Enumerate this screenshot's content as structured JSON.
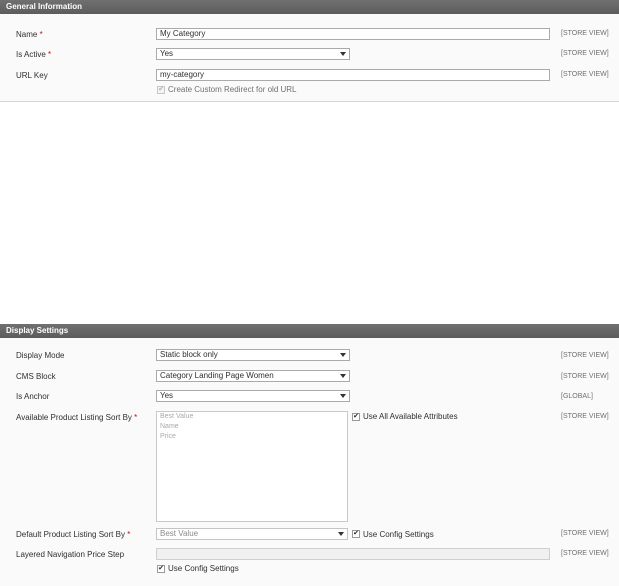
{
  "general": {
    "header": "General Information",
    "name_label": "Name",
    "name_value": "My Category",
    "active_label": "Is Active",
    "active_value": "Yes",
    "urlkey_label": "URL Key",
    "urlkey_value": "my-category",
    "redirect_label": "Create Custom Redirect for old URL",
    "required_mark": "*",
    "scope_store_view": "[STORE VIEW]"
  },
  "display": {
    "header": "Display Settings",
    "mode_label": "Display Mode",
    "mode_value": "Static block only",
    "cms_label": "CMS Block",
    "cms_value": "Category Landing Page Women",
    "anchor_label": "Is Anchor",
    "anchor_value": "Yes",
    "sortby_label": "Available Product Listing Sort By",
    "sortby_options": [
      "Best Value",
      "Name",
      "Price"
    ],
    "use_all_label": "Use All Available Attributes",
    "default_sort_label": "Default Product Listing Sort By",
    "default_sort_value": "Best Value",
    "use_config_label": "Use Config Settings",
    "price_step_label": "Layered Navigation Price Step",
    "price_step_value": "",
    "required_mark": "*",
    "scope_store_view": "[STORE VIEW]",
    "scope_global": "[GLOBAL]"
  },
  "icons": {
    "checkmark": "✔"
  }
}
